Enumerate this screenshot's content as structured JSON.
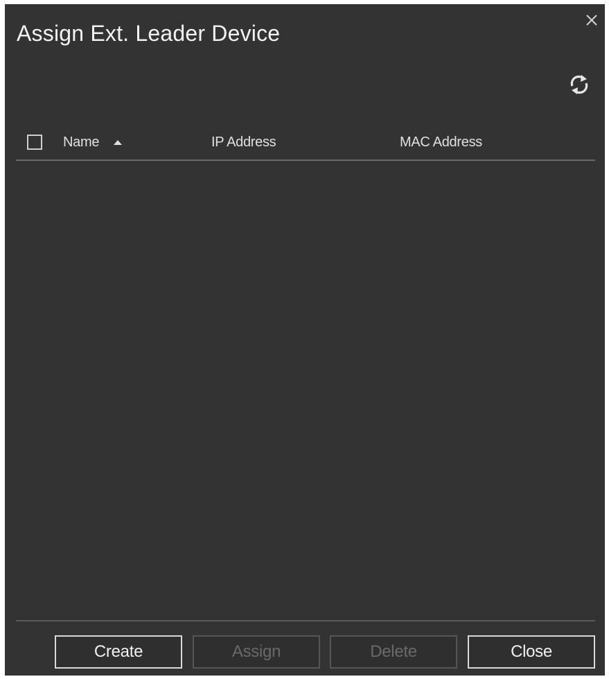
{
  "dialog": {
    "title": "Assign Ext. Leader Device",
    "close_icon": "close-icon",
    "refresh_icon": "refresh-icon"
  },
  "table": {
    "columns": [
      {
        "label": "Name",
        "sort": "ascending"
      },
      {
        "label": "IP Address"
      },
      {
        "label": "MAC Address"
      }
    ],
    "rows": []
  },
  "buttons": {
    "create": {
      "label": "Create",
      "enabled": true
    },
    "assign": {
      "label": "Assign",
      "enabled": false
    },
    "delete": {
      "label": "Delete",
      "enabled": false
    },
    "close": {
      "label": "Close",
      "enabled": true
    }
  },
  "colors": {
    "background": "#333333",
    "text": "#e6e6e6",
    "disabled_text": "#6a6a6a"
  }
}
